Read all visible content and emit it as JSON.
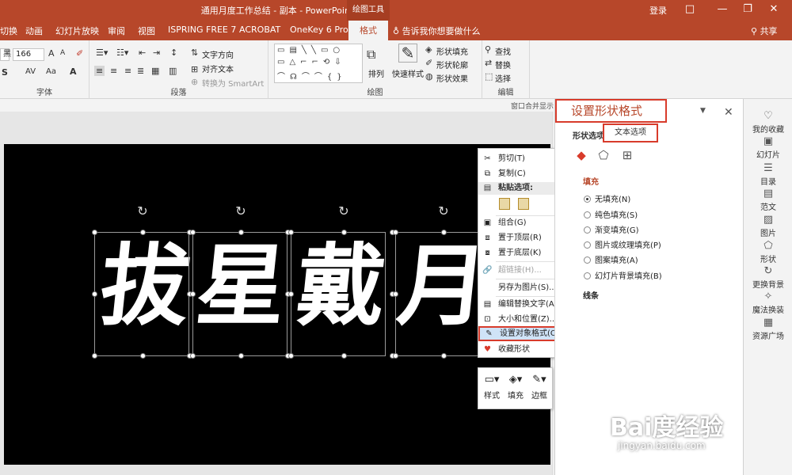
{
  "window": {
    "title": "通用月度工作总结 - 副本  -  PowerPoint",
    "context_tool": "绘图工具",
    "login": "登录",
    "controls": [
      "□",
      "—",
      "❐",
      "✕"
    ]
  },
  "tabs": [
    "切换",
    "动画",
    "幻灯片放映",
    "审阅",
    "视图",
    "ISPRING FREE 7",
    "ACROBAT",
    "OneKey 6 Pro",
    "格式"
  ],
  "active_tab": "格式",
  "tell_me": "告诉我你想要做什么",
  "share": "共享",
  "ribbon": {
    "font": {
      "label": "字体",
      "font_name": "黑",
      "font_size": "166",
      "grow": "A",
      "shrink": "A",
      "shadow": "S",
      "spacing": "AV",
      "case": "Aa",
      "color": "A"
    },
    "paragraph": {
      "label": "段落",
      "text_direction": "文字方向",
      "align_text": "对齐文本",
      "convert_smartart": "转换为 SmartArt"
    },
    "drawing": {
      "label": "绘图",
      "arrange": "排列",
      "quick_styles": "快速样式",
      "shape_fill": "形状填充",
      "shape_outline": "形状轮廓",
      "shape_effects": "形状效果"
    },
    "editing": {
      "label": "编辑",
      "find": "查找",
      "replace": "替换",
      "select": "选择"
    },
    "window_merge": "窗口合并显示"
  },
  "slide": {
    "characters": [
      "拔",
      "星",
      "戴",
      "月"
    ],
    "background": "#000000"
  },
  "context_menu": {
    "items": [
      {
        "label": "剪切(T)",
        "icon": "scissors-icon",
        "glyph": "✂"
      },
      {
        "label": "复制(C)",
        "icon": "copy-icon",
        "glyph": "⧉"
      },
      {
        "label": "粘贴选项:",
        "icon": "paste-icon",
        "glyph": "📋"
      },
      {
        "label": "组合(G)",
        "icon": "group-icon",
        "glyph": "▣"
      },
      {
        "label": "置于顶层(R)",
        "icon": "bring-front-icon",
        "glyph": "⧈"
      },
      {
        "label": "置于底层(K)",
        "icon": "send-back-icon",
        "glyph": "⧇"
      },
      {
        "label": "超链接(H)...",
        "icon": "hyperlink-icon",
        "glyph": "🔗"
      },
      {
        "label": "另存为图片(S)...",
        "icon": "",
        "glyph": ""
      },
      {
        "label": "编辑替换文字(A)...",
        "icon": "alt-text-icon",
        "glyph": "▤"
      },
      {
        "label": "大小和位置(Z)...",
        "icon": "size-position-icon",
        "glyph": "⊡"
      },
      {
        "label": "设置对象格式(O)...",
        "icon": "format-object-icon",
        "glyph": "✎"
      },
      {
        "label": "收藏形状",
        "icon": "heart-icon",
        "glyph": "♥"
      }
    ]
  },
  "mini_toolbar": {
    "style": "样式",
    "fill": "填充",
    "border": "边框"
  },
  "format_pane": {
    "title": "设置形状格式",
    "tab_shape": "形状选项",
    "tab_text": "文本选项",
    "fill_section": "填充",
    "fill_options": [
      "无填充(N)",
      "纯色填充(S)",
      "渐变填充(G)",
      "图片或纹理填充(P)",
      "图案填充(A)",
      "幻灯片背景填充(B)"
    ],
    "selected_fill": "无填充(N)",
    "line_section": "线条",
    "accent": "#b7472a"
  },
  "sidebar": {
    "items": [
      {
        "label": "我的收藏",
        "icon": "favorites-icon",
        "glyph": "♡"
      },
      {
        "label": "幻灯片",
        "icon": "slides-icon",
        "glyph": "▣"
      },
      {
        "label": "目录",
        "icon": "toc-icon",
        "glyph": "☰"
      },
      {
        "label": "范文",
        "icon": "template-icon",
        "glyph": "▤"
      },
      {
        "label": "图片",
        "icon": "picture-icon",
        "glyph": "▨"
      },
      {
        "label": "形状",
        "icon": "shape-icon",
        "glyph": "⬠"
      },
      {
        "label": "更换背景",
        "icon": "refresh-icon",
        "glyph": "↻"
      },
      {
        "label": "魔法换装",
        "icon": "magic-icon",
        "glyph": "✧"
      },
      {
        "label": "资源广场",
        "icon": "grid-icon",
        "glyph": "▦"
      }
    ]
  },
  "watermark": {
    "brand": "Bai度经验",
    "url": "jingyan.baidu.com"
  }
}
